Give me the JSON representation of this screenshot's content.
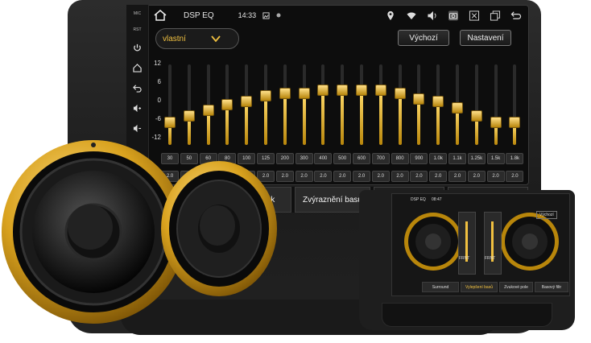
{
  "header": {
    "title": "DSP EQ",
    "time": "14:33"
  },
  "side_strip": {
    "mic_label": "MIC",
    "rst_label": "RST"
  },
  "preset": {
    "selected": "vlastní"
  },
  "buttons": {
    "default_label": "Výchozí",
    "settings_label": "Nastavení"
  },
  "eq": {
    "y_axis_labels": [
      "12",
      "6",
      "0",
      "-6",
      "-12"
    ],
    "bands": [
      {
        "freq": "30",
        "q": "2.0",
        "gain_db": -6
      },
      {
        "freq": "50",
        "q": "2.0",
        "gain_db": -4
      },
      {
        "freq": "60",
        "q": "2.0",
        "gain_db": -2
      },
      {
        "freq": "80",
        "q": "2.0",
        "gain_db": 0
      },
      {
        "freq": "100",
        "q": "2.0",
        "gain_db": 1
      },
      {
        "freq": "125",
        "q": "2.0",
        "gain_db": 3
      },
      {
        "freq": "200",
        "q": "2.0",
        "gain_db": 4
      },
      {
        "freq": "300",
        "q": "2.0",
        "gain_db": 4
      },
      {
        "freq": "400",
        "q": "2.0",
        "gain_db": 5
      },
      {
        "freq": "500",
        "q": "2.0",
        "gain_db": 5
      },
      {
        "freq": "600",
        "q": "2.0",
        "gain_db": 5
      },
      {
        "freq": "700",
        "q": "2.0",
        "gain_db": 5
      },
      {
        "freq": "800",
        "q": "2.0",
        "gain_db": 4
      },
      {
        "freq": "900",
        "q": "2.0",
        "gain_db": 2
      },
      {
        "freq": "1.0k",
        "q": "2.0",
        "gain_db": 1
      },
      {
        "freq": "1.1k",
        "q": "2.0",
        "gain_db": -1
      },
      {
        "freq": "1.25k",
        "q": "2.0",
        "gain_db": -4
      },
      {
        "freq": "1.5k",
        "q": "2.0",
        "gain_db": -6
      },
      {
        "freq": "1.8k",
        "q": "2.0",
        "gain_db": -6
      }
    ]
  },
  "tabs": {
    "sound_partial": "zvuk",
    "bass_boost": "Zvýraznění basů"
  },
  "mini": {
    "title": "DSP EQ",
    "time": "08:47",
    "default_label": "Výchozí",
    "tabs": [
      "Surround",
      "Vylepšení basů",
      "Zvukové pole",
      "Basový filtr"
    ],
    "labels": [
      "FRNT",
      "FRNT"
    ]
  },
  "colors": {
    "accent": "#f0c040",
    "gold_dark": "#b8860b",
    "bezel": "#1e1e1e"
  }
}
